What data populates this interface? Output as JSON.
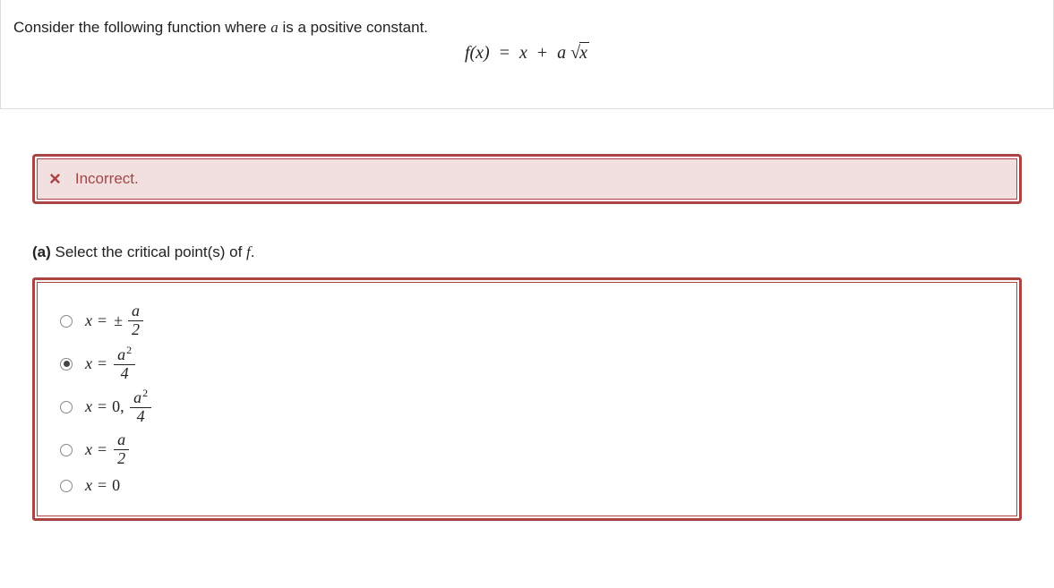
{
  "question": {
    "prompt_prefix": "Consider the following function where ",
    "prompt_var": "a",
    "prompt_suffix": " is a positive constant.",
    "formula": {
      "lhs": "f(x)",
      "x_term": "x",
      "coef": "a",
      "radicand": "x"
    }
  },
  "feedback": {
    "icon": "×",
    "text": "Incorrect."
  },
  "part": {
    "label": "(a)",
    "text_prefix": " Select the critical point(s) of ",
    "func": "f",
    "text_suffix": "."
  },
  "options": [
    {
      "selected": false,
      "type": "pm_frac",
      "num": "a",
      "den": "2"
    },
    {
      "selected": true,
      "type": "frac",
      "num": "a",
      "num_sup": "2",
      "den": "4"
    },
    {
      "selected": false,
      "type": "zero_frac",
      "num": "a",
      "num_sup": "2",
      "den": "4"
    },
    {
      "selected": false,
      "type": "frac",
      "num": "a",
      "den": "2"
    },
    {
      "selected": false,
      "type": "zero"
    }
  ]
}
